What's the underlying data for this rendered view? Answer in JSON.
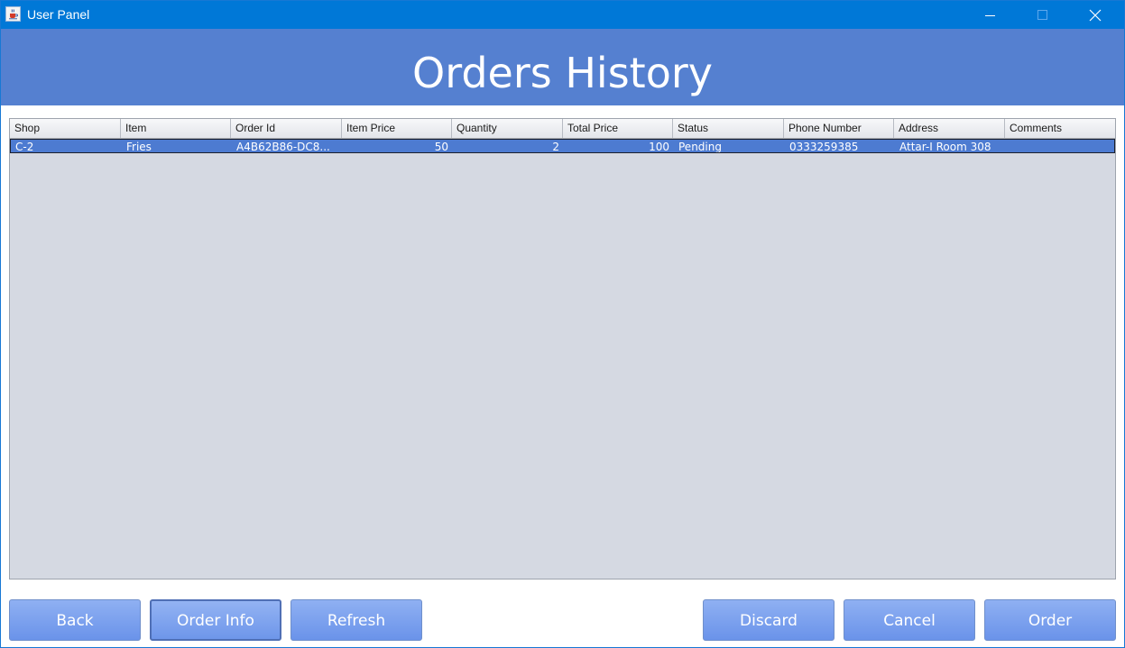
{
  "window": {
    "title": "User Panel"
  },
  "header": {
    "title": "Orders History"
  },
  "table": {
    "columns": [
      "Shop",
      "Item",
      "Order Id",
      "Item Price",
      "Quantity",
      "Total Price",
      "Status",
      "Phone Number",
      "Address",
      "Comments"
    ],
    "rows": [
      {
        "shop": "C-2",
        "item": "Fries",
        "order_id": "A4B62B86-DC8...",
        "item_price": "50",
        "quantity": "2",
        "total_price": "100",
        "status": "Pending",
        "phone": "0333259385",
        "address": "Attar-I Room 308",
        "comments": ""
      }
    ]
  },
  "buttons": {
    "back": "Back",
    "order_info": "Order Info",
    "refresh": "Refresh",
    "discard": "Discard",
    "cancel": "Cancel",
    "order": "Order"
  },
  "colors": {
    "titlebar": "#0078d7",
    "header_band": "#5580d0",
    "selection": "#4d7bd1",
    "table_bg": "#d5d9e2",
    "button": "#7aa0ee"
  },
  "icons": {
    "app": "java-coffee-icon",
    "minimize": "minimize-icon",
    "maximize": "maximize-icon",
    "close": "close-icon"
  }
}
